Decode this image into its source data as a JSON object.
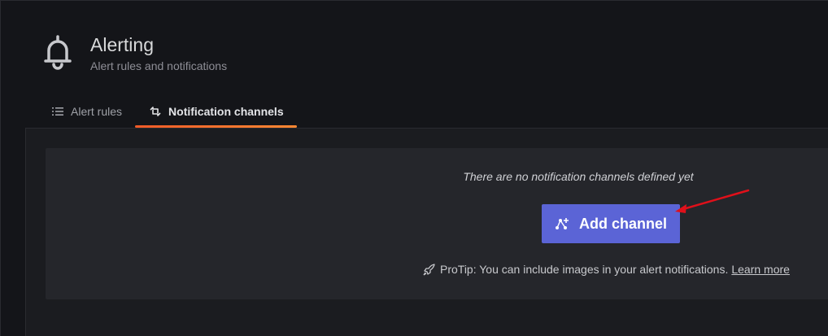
{
  "header": {
    "icon": "bell-icon",
    "title": "Alerting",
    "subtitle": "Alert rules and notifications"
  },
  "tabs": [
    {
      "label": "Alert rules",
      "icon": "list-icon",
      "active": false
    },
    {
      "label": "Notification channels",
      "icon": "channel-icon",
      "active": true
    }
  ],
  "empty_state": {
    "message": "There are no notification channels defined yet",
    "button_label": "Add channel",
    "button_icon": "share-plus-icon",
    "protip_text": "ProTip: You can include images in your alert notifications.",
    "protip_icon": "rocket-icon",
    "learn_more": "Learn more"
  },
  "colors": {
    "background": "#141519",
    "panel": "#25262b",
    "button": "#5b64d6",
    "tab_underline": "#f05a28",
    "annotation_arrow": "#e0101a"
  }
}
